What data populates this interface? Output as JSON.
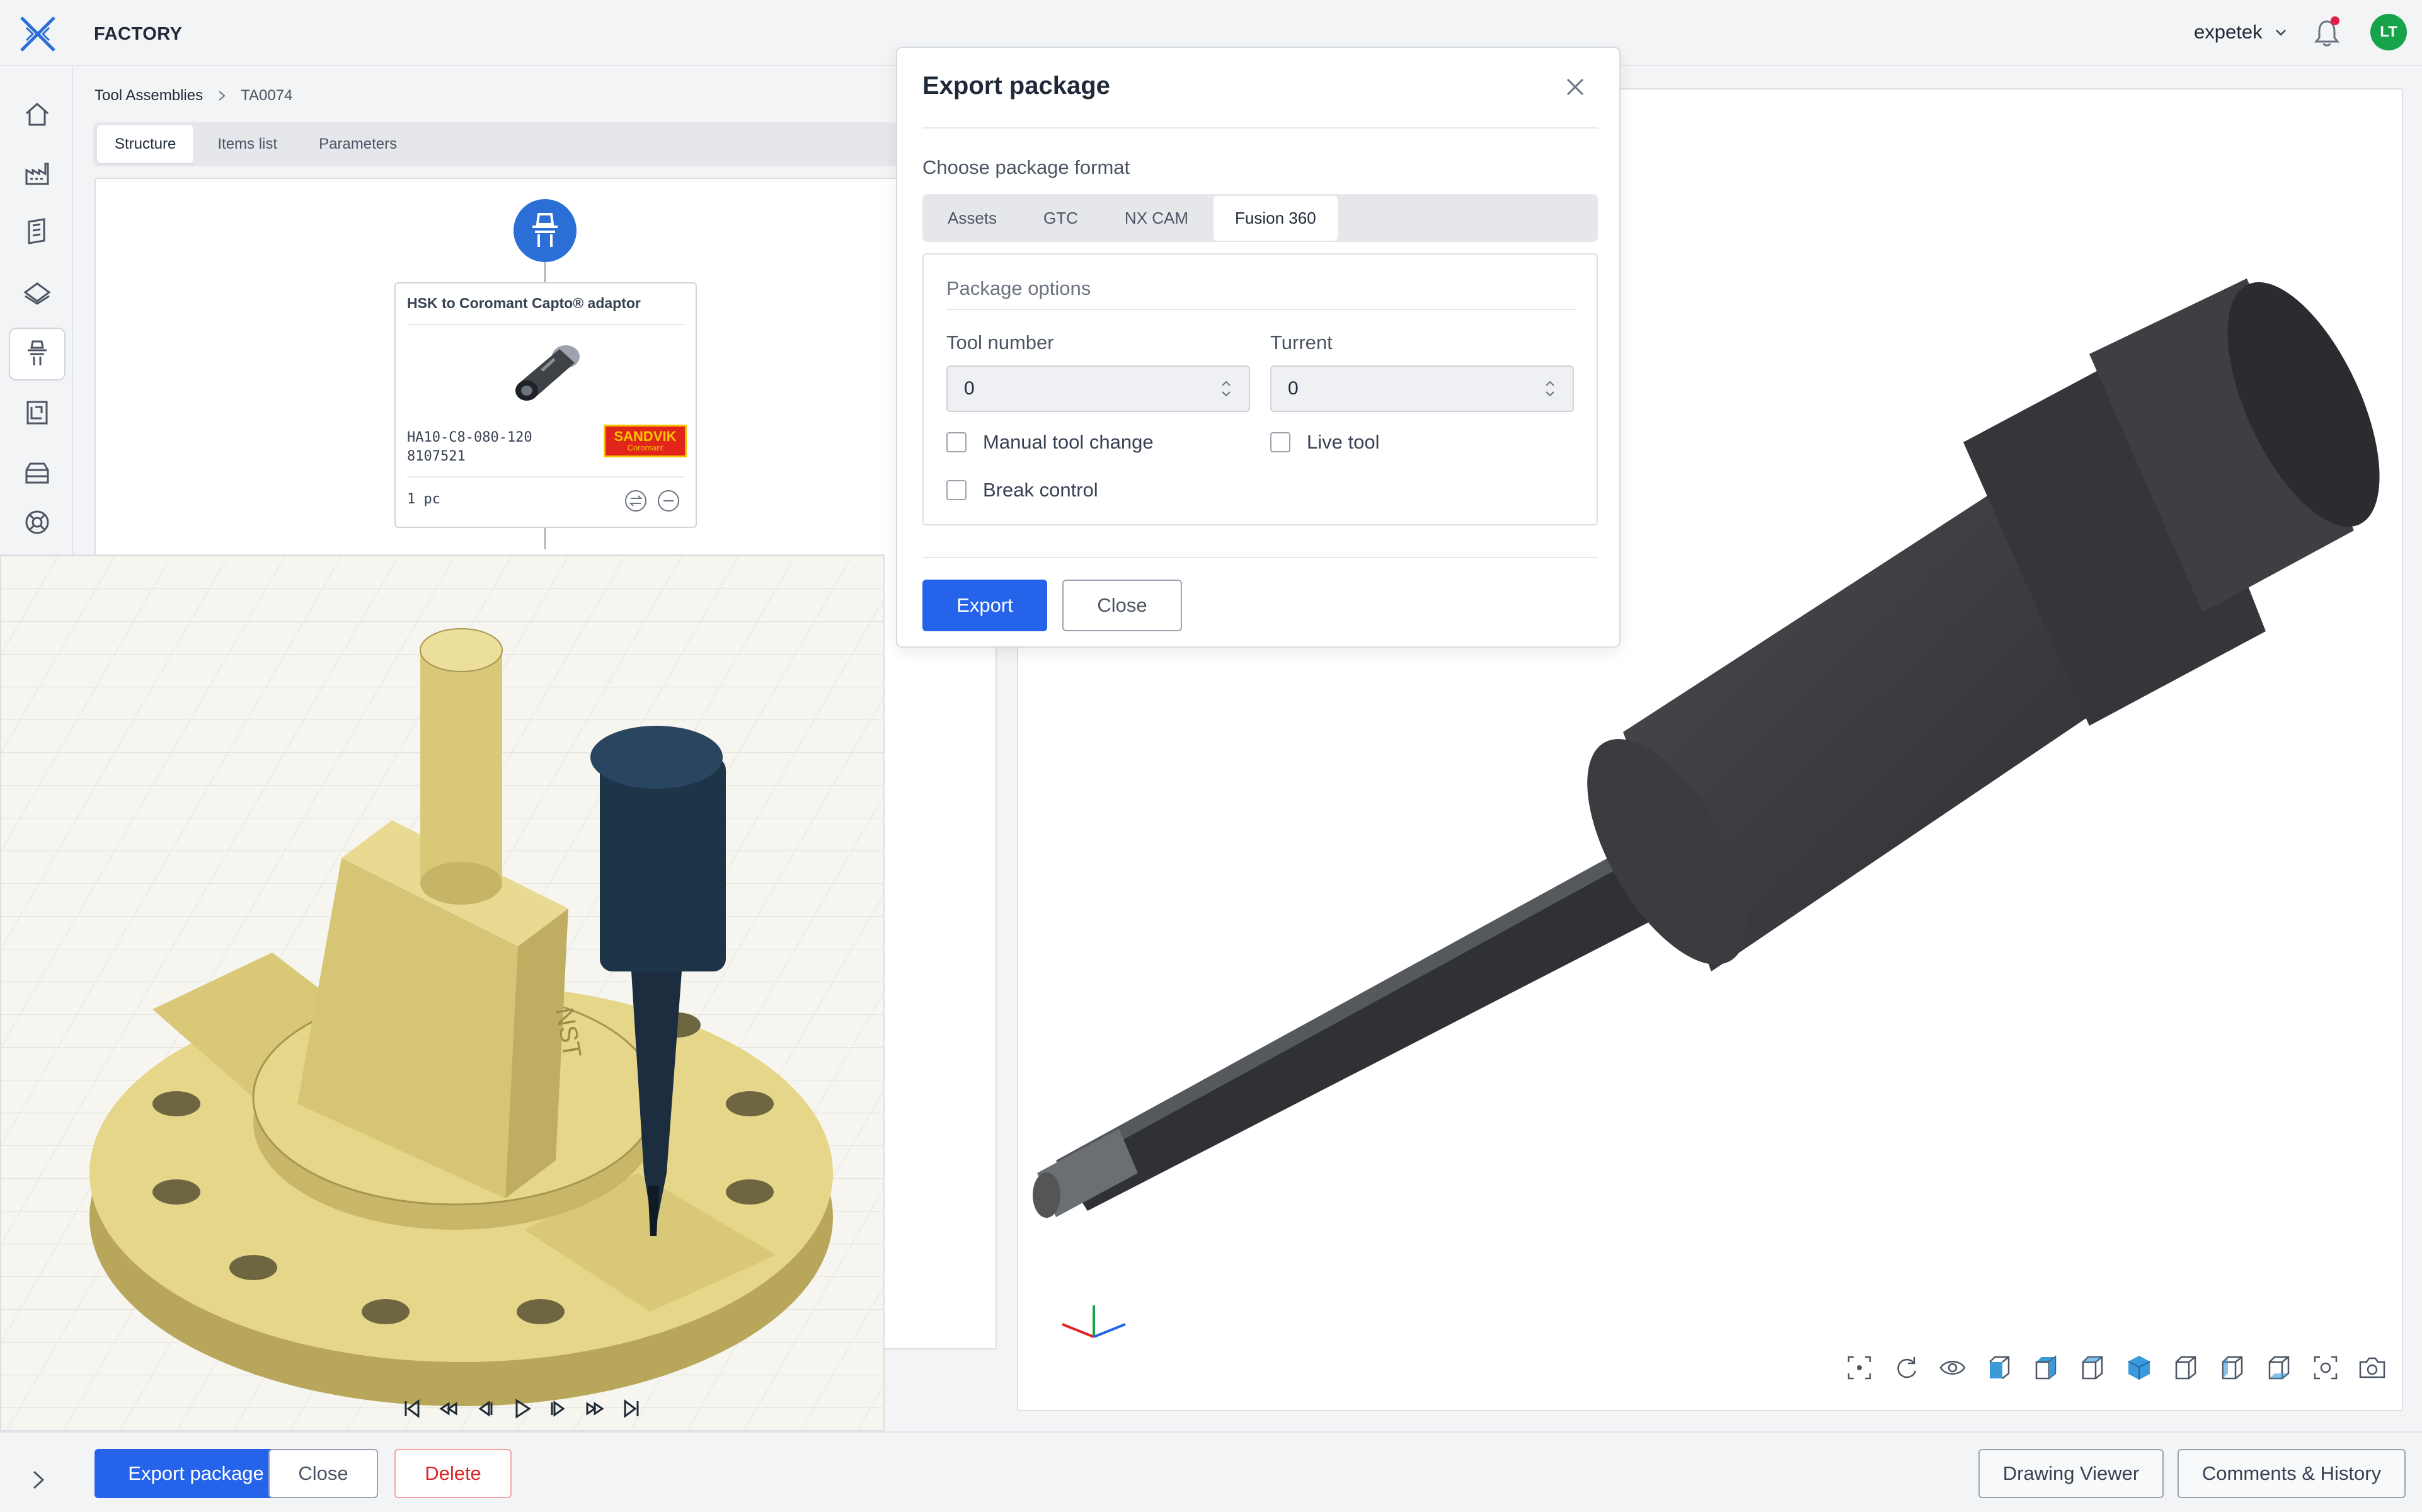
{
  "header": {
    "app_title": "FACTORY",
    "username": "expetek",
    "avatar_initials": "LT",
    "accent_color": "#2563eb",
    "avatar_color": "#16a34a"
  },
  "sidebar": {
    "items": [
      {
        "name": "home-icon"
      },
      {
        "name": "factory-icon"
      },
      {
        "name": "catalog-icon"
      },
      {
        "name": "layers-icon"
      },
      {
        "name": "tool-assembly-icon",
        "active": true
      },
      {
        "name": "drawing-icon"
      },
      {
        "name": "storage-icon"
      },
      {
        "name": "support-icon"
      }
    ]
  },
  "breadcrumb": {
    "root": "Tool Assemblies",
    "current": "TA0074"
  },
  "tabs": {
    "structure": "Structure",
    "items_list": "Items list",
    "parameters": "Parameters"
  },
  "card": {
    "title": "HSK to Coromant Capto® adaptor",
    "code": "HA10-C8-080-120",
    "number": "8107521",
    "brand_line1": "SANDVIK",
    "brand_line2": "Coromant",
    "quantity": "1 pc"
  },
  "modal": {
    "title": "Export package",
    "format_label": "Choose package format",
    "formats": [
      "Assets",
      "GTC",
      "NX CAM",
      "Fusion 360"
    ],
    "selected_format": "Fusion 360",
    "options_title": "Package options",
    "tool_number_label": "Tool number",
    "tool_number_value": "0",
    "turrent_label": "Turrent",
    "turrent_value": "0",
    "manual_tool_change": "Manual tool change",
    "live_tool": "Live tool",
    "break_control": "Break control",
    "export_button": "Export",
    "close_button": "Close"
  },
  "sim": {
    "fixture_text": "NST"
  },
  "bottom": {
    "export_package": "Export package",
    "close": "Close",
    "delete": "Delete",
    "drawing_viewer": "Drawing Viewer",
    "comments_history": "Comments & History"
  }
}
